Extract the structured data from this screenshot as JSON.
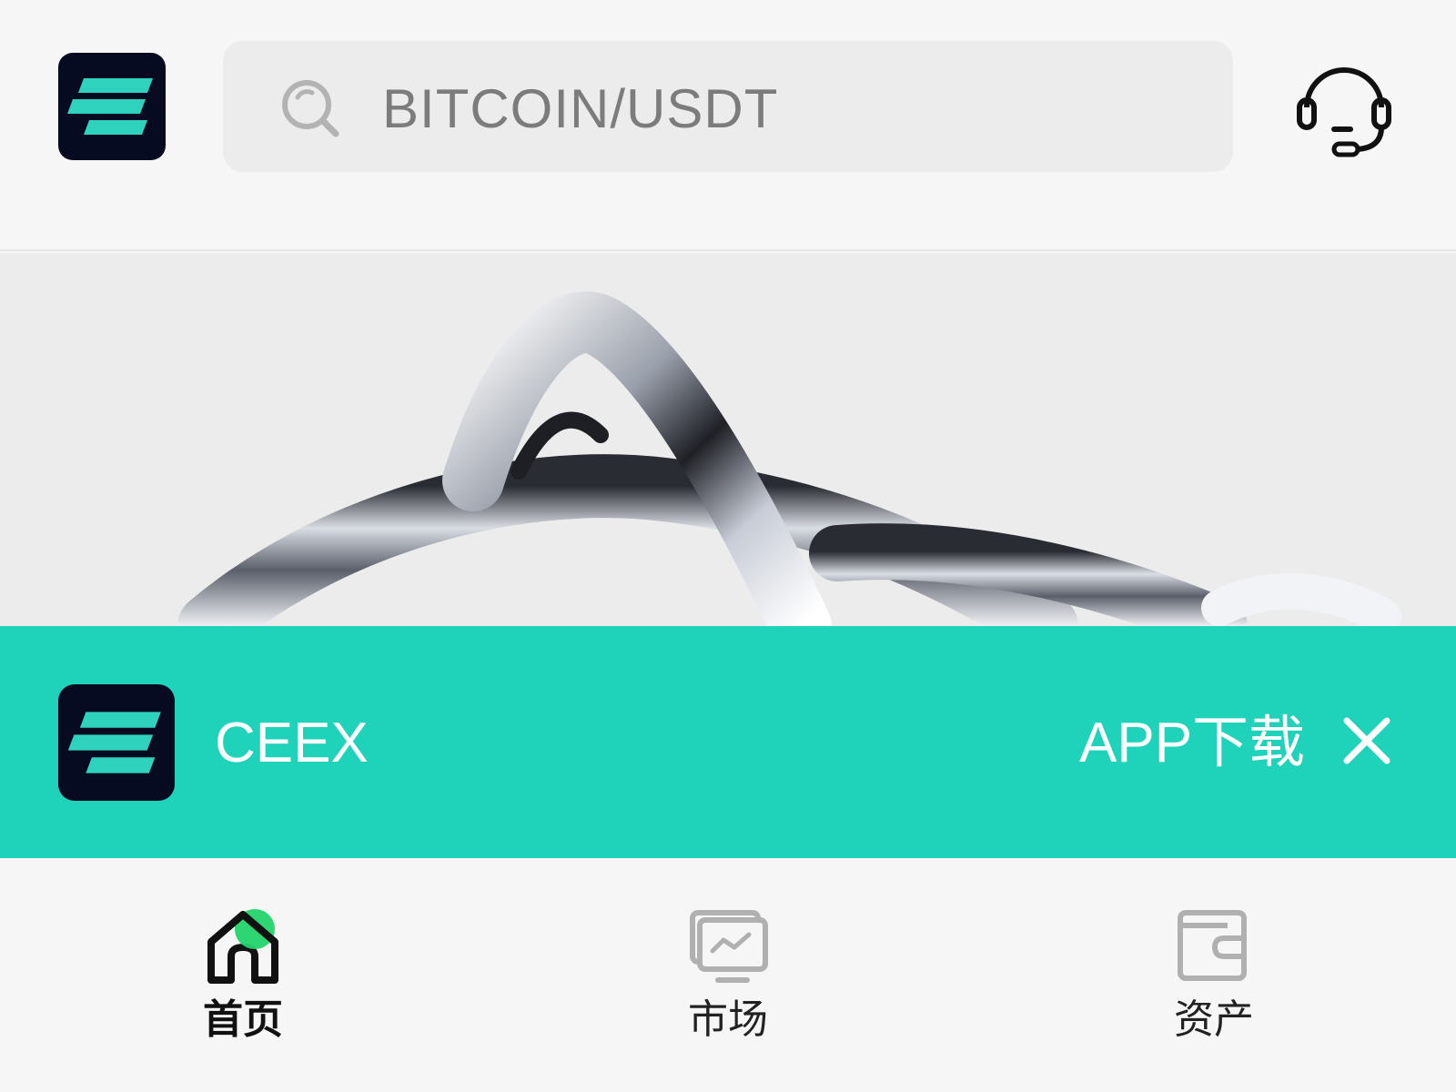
{
  "header": {
    "search": {
      "placeholder": "BITCOIN/USDT"
    }
  },
  "download_bar": {
    "app_name": "CEEX",
    "download_label": "APP下载"
  },
  "bottom_nav": {
    "items": [
      {
        "label": "首页",
        "icon": "home-icon",
        "active": true
      },
      {
        "label": "市场",
        "icon": "market-monitor-icon",
        "active": false
      },
      {
        "label": "资产",
        "icon": "wallet-icon",
        "active": false
      }
    ]
  },
  "colors": {
    "accent": "#1fd3bb",
    "logo_bg": "#070b22",
    "active_dot": "#22d36b",
    "page_bg": "#f6f6f6"
  }
}
